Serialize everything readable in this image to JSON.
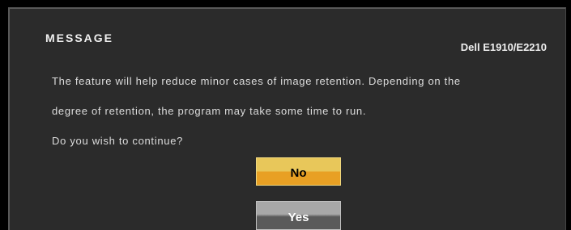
{
  "dialog": {
    "title": "MESSAGE",
    "model": "Dell E1910/E2210",
    "lines": [
      "The feature will help reduce minor cases of image retention. Depending on the",
      "degree of retention, the program may take some time to run.",
      "Do you wish to continue?"
    ],
    "buttons": {
      "no_label": "No",
      "yes_label": "Yes"
    }
  },
  "colors": {
    "background": "#000000",
    "panel": "#2b2b2b",
    "selected_button": "#e8a024",
    "unselected_button": "#5a5a5a"
  }
}
